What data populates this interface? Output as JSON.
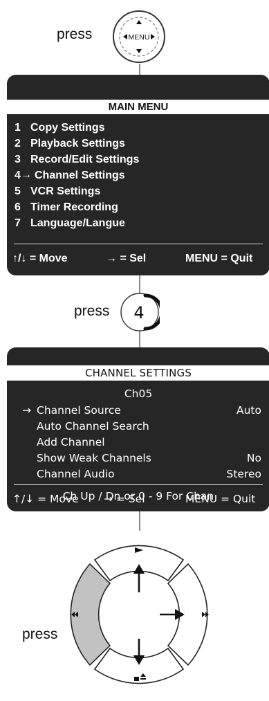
{
  "step1": {
    "press_label": "press",
    "button_label": "MENU"
  },
  "main_menu": {
    "title": "MAIN MENU",
    "items": [
      {
        "num": "1",
        "label": "Copy Settings"
      },
      {
        "num": "2",
        "label": "Playback Settings"
      },
      {
        "num": "3",
        "label": "Record/Edit Settings"
      },
      {
        "num": "4",
        "label": "Channel Settings"
      },
      {
        "num": "5",
        "label": "VCR Settings"
      },
      {
        "num": "6",
        "label": "Timer Recording"
      },
      {
        "num": "7",
        "label": "Language/Langue"
      }
    ],
    "footer": {
      "move": "↑/↓ = Move",
      "sel": "→ = Sel",
      "quit": "MENU = Quit"
    }
  },
  "step2": {
    "press_label": "press",
    "button_label": "4"
  },
  "channel_settings": {
    "title": "CHANNEL SETTINGS",
    "channel": "Ch05",
    "items": [
      {
        "label": "Channel Source",
        "value": "Auto"
      },
      {
        "label": "Auto Channel Search",
        "value": ""
      },
      {
        "label": "Add Channel",
        "value": ""
      },
      {
        "label": "Show Weak Channels",
        "value": "No"
      },
      {
        "label": "Channel Audio",
        "value": "Stereo"
      }
    ],
    "hint": "Ch Up / Dn or 0 - 9 For Chan",
    "footer": {
      "move": "↑/↓ = Move",
      "sel": "→ = Sel",
      "quit": "MENU = Quit"
    }
  },
  "step3": {
    "press_label": "press"
  },
  "colors": {
    "screen_bg": "#262626",
    "highlight_segment": "#c2c2c2",
    "line": "#8a8a8a"
  }
}
